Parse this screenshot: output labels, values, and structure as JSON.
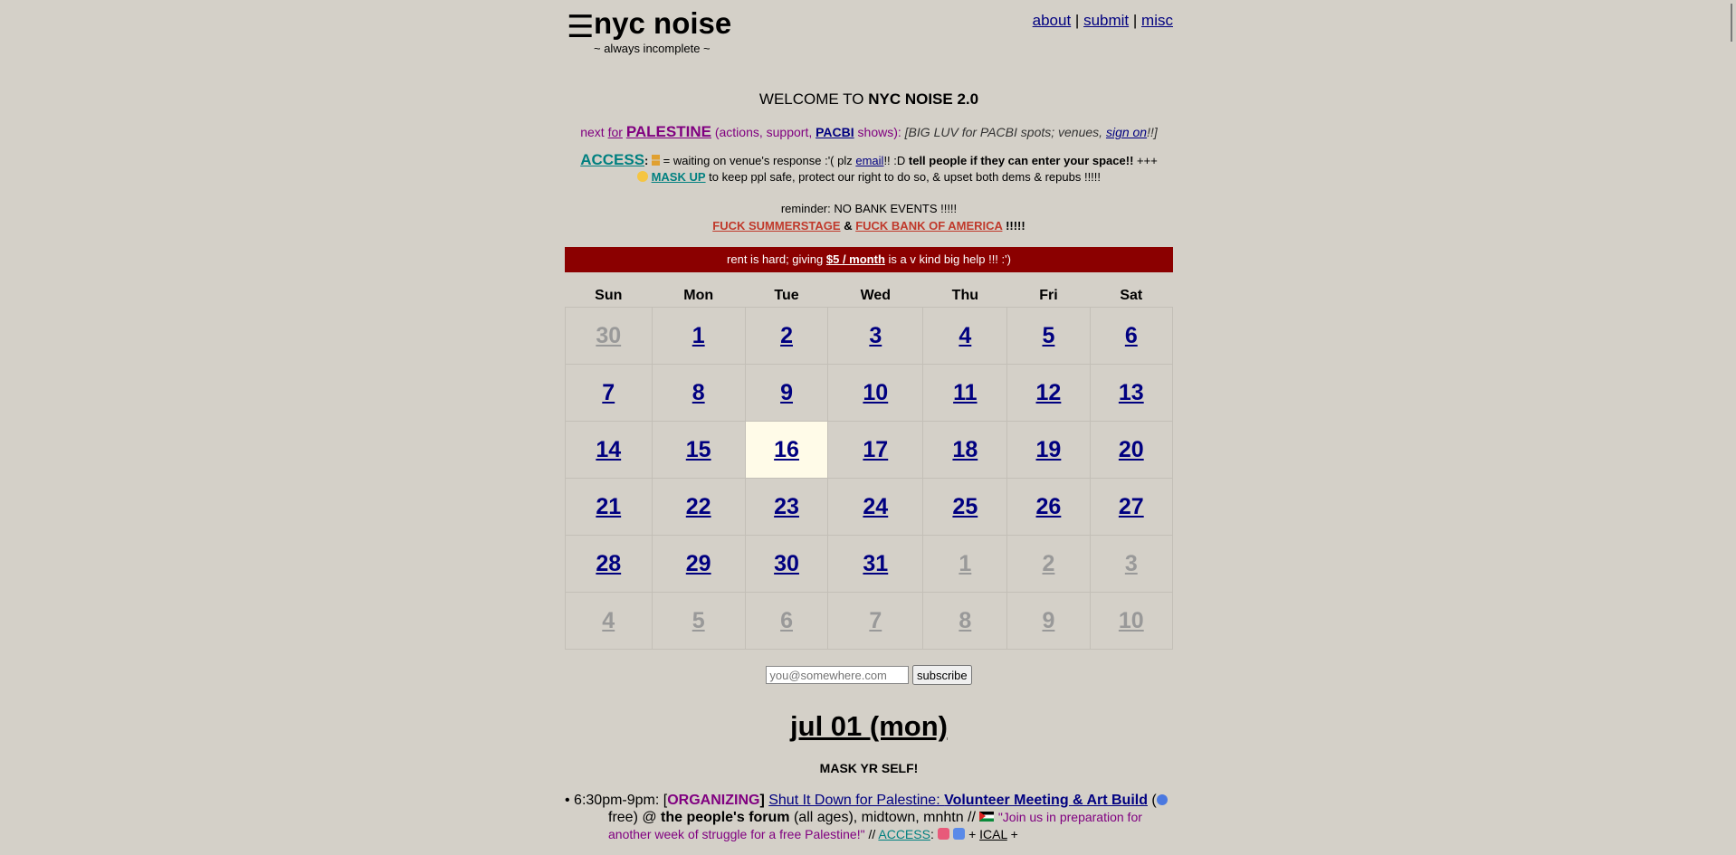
{
  "header": {
    "menu_icon": "☰",
    "title": "nyc noise",
    "tagline": "~ always incomplete ~",
    "nav": [
      "about",
      "submit",
      "misc"
    ],
    "nav_sep": "|"
  },
  "welcome": {
    "prefix": "WELCOME TO ",
    "name": "NYC NOISE 2.0"
  },
  "palestine": {
    "next": "next ",
    "for": "for",
    "palestine": "PALESTINE",
    "mid": " (actions, support, ",
    "pacbi": "PACBI",
    "shows": " shows): ",
    "luv": "[BIG LUV for PACBI spots; venues, ",
    "sign_on": "sign on",
    "luv_end": "!!]"
  },
  "access": {
    "label": "ACCESS",
    "colon": ":",
    "waiting": " = waiting on venue's response :'( plz ",
    "email": "email",
    "after_email": "!! :D ",
    "tell": "tell people if they can enter your space!!",
    "plus": " +++",
    "mask_up": "MASK UP",
    "mask_text": " to keep ppl safe, protect our right to do so, & upset both dems & repubs !!!!!"
  },
  "reminder": {
    "line1": "reminder: NO BANK EVENTS !!!!!",
    "summerstage": "FUCK SUMMERSTAGE",
    "amp": " & ",
    "boa": "FUCK BANK OF AMERICA",
    "bang": " !!!!!"
  },
  "donate": {
    "pre": "rent is hard; giving ",
    "link": "$5 / month",
    "post": " is a v kind big help !!! :')"
  },
  "calendar": {
    "days": [
      "Sun",
      "Mon",
      "Tue",
      "Wed",
      "Thu",
      "Fri",
      "Sat"
    ],
    "weeks": [
      [
        "30",
        "1",
        "2",
        "3",
        "4",
        "5",
        "6"
      ],
      [
        "7",
        "8",
        "9",
        "10",
        "11",
        "12",
        "13"
      ],
      [
        "14",
        "15",
        "16",
        "17",
        "18",
        "19",
        "20"
      ],
      [
        "21",
        "22",
        "23",
        "24",
        "25",
        "26",
        "27"
      ],
      [
        "28",
        "29",
        "30",
        "31",
        "1",
        "2",
        "3"
      ],
      [
        "4",
        "5",
        "6",
        "7",
        "8",
        "9",
        "10"
      ]
    ],
    "today": "16"
  },
  "subscribe": {
    "placeholder": "you@somewhere.com",
    "button": "subscribe"
  },
  "day": {
    "heading": "jul 01 (mon)",
    "mask_notice": "MASK YR SELF!"
  },
  "event": {
    "bullet": "•",
    "time": " 6:30pm-9pm: [",
    "tag": "ORGANIZING",
    "tag_close": "] ",
    "title_a": "Shut It Down for Palestine: ",
    "title_b": "Volunteer Meeting & Art Build",
    "price_open": " (",
    "price": " free) @ ",
    "venue": "the people's forum",
    "venue_rest": " (all ages), midtown, mnhtn // ",
    "quote": "\"Join us in preparation for another week of struggle for a free Palestine!\"",
    "sep": " // ",
    "access": "ACCESS",
    "access_colon": ": ",
    "plus": " + ",
    "ical": "ICAL",
    "end": " +"
  },
  "colors": {
    "background": "#d4d0c8",
    "link": "#000080",
    "purple": "#800080",
    "teal": "#008080",
    "red": "#c0392b",
    "donate_bar": "#8b0000",
    "today_cell": "#fffbe8"
  }
}
